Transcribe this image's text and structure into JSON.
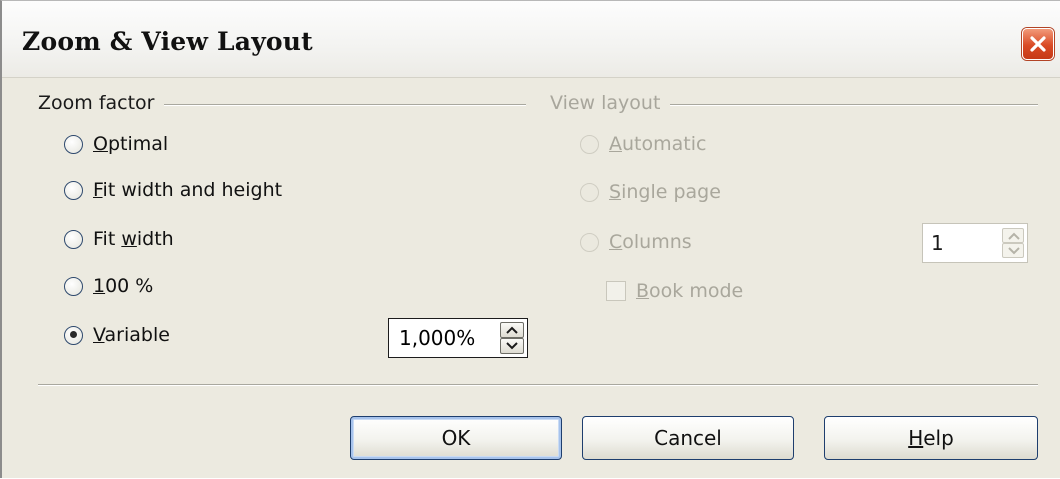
{
  "window": {
    "title": "Zoom & View Layout",
    "close_icon": "close-x-icon",
    "accent_close": "#d94a25"
  },
  "zoom": {
    "label": "Zoom factor",
    "options": [
      {
        "label_pre": "",
        "label_key": "O",
        "label_post": "ptimal",
        "selected": false
      },
      {
        "label_pre": "",
        "label_key": "F",
        "label_post": "it width and height",
        "selected": false
      },
      {
        "label_pre": "Fit ",
        "label_key": "w",
        "label_post": "idth",
        "selected": false
      },
      {
        "label_pre": "",
        "label_key": "1",
        "label_post": "00 %",
        "selected": false
      },
      {
        "label_pre": "",
        "label_key": "V",
        "label_post": "ariable",
        "selected": true
      }
    ],
    "variable_value": "1,000%"
  },
  "view": {
    "label": "View layout",
    "options": [
      {
        "label_pre": "",
        "label_key": "A",
        "label_post": "utomatic"
      },
      {
        "label_pre": "",
        "label_key": "S",
        "label_post": "ingle page"
      },
      {
        "label_pre": "",
        "label_key": "C",
        "label_post": "olumns"
      }
    ],
    "columns_value": "1",
    "book_mode": {
      "label_key": "B",
      "label_post": "ook mode",
      "checked": false
    }
  },
  "buttons": {
    "ok": "OK",
    "cancel": "Cancel",
    "help_key": "H",
    "help_post": "elp"
  }
}
